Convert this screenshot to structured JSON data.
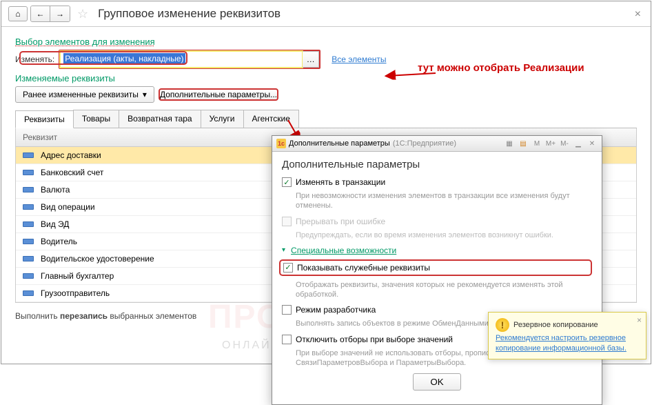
{
  "header": {
    "title": "Групповое изменение реквизитов"
  },
  "section1": {
    "title": "Выбор элементов для изменения",
    "change_label": "Изменять:",
    "input_value": "Реализация (акты, накладные)",
    "all_link": "Все элементы",
    "callout": "тут можно отобрать Реализации"
  },
  "section2": {
    "title": "Изменяемые реквизиты",
    "history_btn": "Ранее измененные реквизиты",
    "extra_btn": "Дополнительные параметры..."
  },
  "tabs": [
    "Реквизиты",
    "Товары",
    "Возвратная тара",
    "Услуги",
    "Агентские"
  ],
  "grid": {
    "header": "Реквизит",
    "rows": [
      "Адрес доставки",
      "Банковский счет",
      "Валюта",
      "Вид операции",
      "Вид ЭД",
      "Водитель",
      "Водительское удостоверение",
      "Главный бухгалтер",
      "Грузоотправитель"
    ]
  },
  "footer": {
    "prefix": "Выполнить ",
    "bold": "перезапись",
    "suffix": " выбранных элементов"
  },
  "popup": {
    "window_title": "Дополнительные параметры",
    "window_app": "(1С:Предприятие)",
    "title": "Дополнительные параметры",
    "tx_check": "Изменять в транзакции",
    "tx_hint": "При невозможности изменения элементов в транзакции все изменения будут отменены.",
    "abort_check": "Прерывать при ошибке",
    "abort_hint": "Предупреждать, если во время изменения элементов возникнут ошибки.",
    "special_title": "Специальные возможности",
    "svc_check": "Показывать служебные реквизиты",
    "svc_hint": "Отображать реквизиты, значения которых не рекомендуется изменять этой обработкой.",
    "dev_check": "Режим разработчика",
    "dev_hint": "Выполнять запись объектов в режиме ОбменДанными.Загрузка = Истина.",
    "filt_check": "Отключить отборы при выборе значений",
    "filt_hint": "При выборе значений не использовать отборы, прописанные в свойствах СвязиПараметровВыбора и ПараметрыВыбора.",
    "ok": "OK"
  },
  "notif": {
    "title": "Резервное копирование",
    "text": "Рекомендуется настроить резервное копирование информационной базы."
  },
  "watermark": {
    "big": "ПРОФБУХ8",
    "sub": "ОНЛАЙН-СЕМИНАРЫ И ВИДЕОКУРСЫ 1С"
  }
}
